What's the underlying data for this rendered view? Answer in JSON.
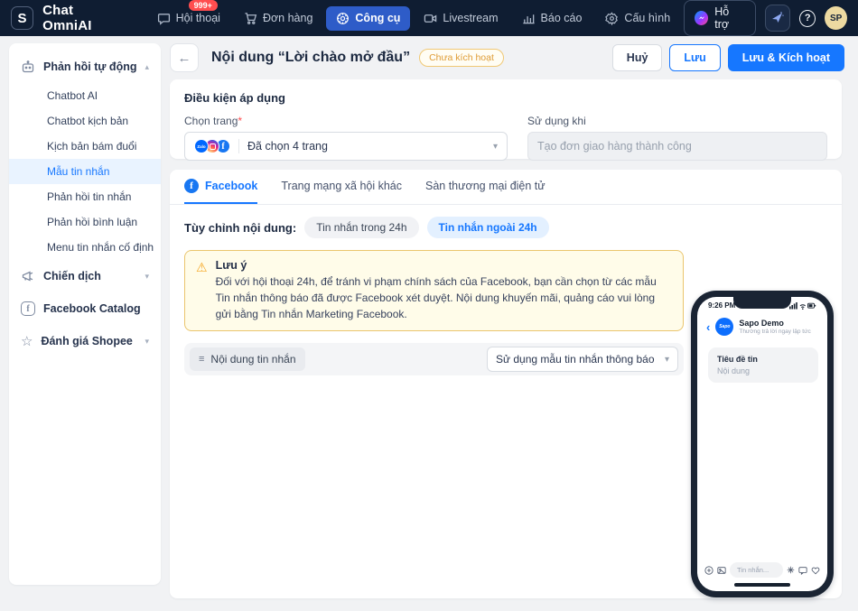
{
  "navbar": {
    "brand": "Chat OmniAI",
    "brand_initial": "S",
    "conversation_badge": "999+",
    "items": [
      {
        "label": "Hội thoại"
      },
      {
        "label": "Đơn hàng"
      },
      {
        "label": "Công cụ"
      },
      {
        "label": "Livestream"
      },
      {
        "label": "Báo cáo"
      },
      {
        "label": "Cấu hình"
      }
    ],
    "support_label": "Hỗ trợ",
    "help_glyph": "?",
    "avatar_initials": "SP"
  },
  "sidebar": {
    "sections": [
      {
        "label": "Phản hồi tự động",
        "state": "expanded"
      },
      {
        "label": "Chiến dịch",
        "state": "collapsed"
      },
      {
        "label": "Facebook Catalog",
        "state": "none"
      },
      {
        "label": "Đánh giá Shopee",
        "state": "collapsed"
      }
    ],
    "auto_reply_children": [
      {
        "label": "Chatbot AI",
        "active": false
      },
      {
        "label": "Chatbot kịch bản",
        "active": false
      },
      {
        "label": "Kịch bản bám đuổi",
        "active": false
      },
      {
        "label": "Mẫu tin nhắn",
        "active": true
      },
      {
        "label": "Phản hồi tin nhắn",
        "active": false
      },
      {
        "label": "Phản hồi bình luận",
        "active": false
      },
      {
        "label": "Menu tin nhắn cố định",
        "active": false
      }
    ]
  },
  "header": {
    "title": "Nội dung “Lời chào mở đầu”",
    "status_badge": "Chưa kích hoạt",
    "cancel_label": "Huỷ",
    "save_label": "Lưu",
    "save_activate_label": "Lưu & Kích hoạt"
  },
  "conditions": {
    "title": "Điều kiện áp dụng",
    "page_select": {
      "label": "Chọn trang",
      "required_mark": "*",
      "value": "Đã chọn 4 trang",
      "icons": [
        "zalo-icon",
        "instagram-icon",
        "facebook-icon"
      ]
    },
    "usage": {
      "label": "Sử dụng khi",
      "value": "Tạo đơn giao hàng thành công"
    }
  },
  "content": {
    "tabs": [
      {
        "label": "Facebook",
        "active": true
      },
      {
        "label": "Trang mạng xã hội khác",
        "active": false
      },
      {
        "label": "Sàn thương mại điện tử",
        "active": false
      }
    ],
    "customize_label": "Tùy chỉnh nội dung:",
    "pills": [
      {
        "label": "Tin nhắn trong 24h",
        "active": false
      },
      {
        "label": "Tin nhắn ngoài 24h",
        "active": true
      }
    ],
    "warning": {
      "title": "Lưu ý",
      "text": "Đối với hội thoại 24h, để tránh vi phạm chính sách của Facebook, bạn cần chọn từ các mẫu Tin nhắn thông báo đã được Facebook xét duyệt. Nội dung khuyến mãi, quảng cáo vui lòng gửi bằng Tin nhắn Marketing Facebook."
    },
    "message_row": {
      "chip_label": "Nội dung tin nhắn",
      "select_value": "Sử dụng mẫu tin nhắn thông báo"
    }
  },
  "phone": {
    "time": "9:26 PM",
    "contact_name": "Sapo Demo",
    "contact_status": "Thường trả lời ngay lập tức",
    "logo_text": "Sapo",
    "message_title": "Tiêu đề tin",
    "message_body": "Nội dung",
    "input_placeholder": "Tin nhắn..."
  },
  "colors": {
    "navbar_bg": "#0f1d32",
    "nav_active_bg": "#2e5cc8",
    "primary_blue": "#1677ff",
    "facebook_blue": "#1877f2",
    "zalo_blue": "#0068ff",
    "badge_red": "#ff4d4f",
    "warning_border": "#eac56d",
    "warning_bg": "#fffce9",
    "status_badge_text": "#df9c35",
    "sidebar_active_bg": "#e9f3ff",
    "page_bg": "#f1f2f4"
  }
}
